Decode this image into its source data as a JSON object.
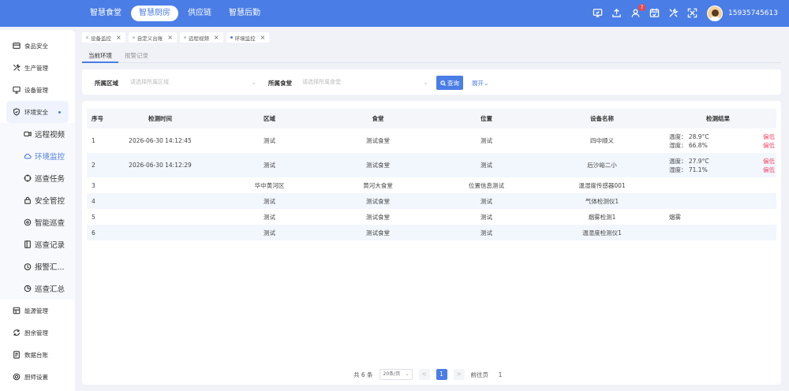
{
  "topnav": {
    "items": [
      "智慧食堂",
      "智慧厨房",
      "供应链",
      "智慧后勤"
    ],
    "active": 1,
    "badge_count": "7",
    "phone": "15935745613"
  },
  "sidebar": {
    "items": [
      {
        "label": "食品安全",
        "icon": "food-safety-icon"
      },
      {
        "label": "生产管理",
        "icon": "tools-icon"
      },
      {
        "label": "设备管理",
        "icon": "monitor-icon"
      },
      {
        "label": "环境安全",
        "icon": "shield-icon"
      }
    ],
    "sub_items": [
      {
        "label": "远程视频",
        "icon": "video-icon"
      },
      {
        "label": "环境监控",
        "icon": "cloud-icon"
      },
      {
        "label": "巡查任务",
        "icon": "target-icon"
      },
      {
        "label": "安全管控",
        "icon": "lock-icon"
      },
      {
        "label": "智能巡查",
        "icon": "smart-icon"
      },
      {
        "label": "巡查记录",
        "icon": "record-icon"
      },
      {
        "label": "报警汇...",
        "icon": "alarm-icon"
      },
      {
        "label": "巡查汇总",
        "icon": "pie-icon"
      }
    ],
    "bottom_items": [
      {
        "label": "能源管理",
        "icon": "energy-icon"
      },
      {
        "label": "厨余管理",
        "icon": "waste-icon"
      },
      {
        "label": "数据台账",
        "icon": "ledger-icon"
      },
      {
        "label": "厨师设置",
        "icon": "settings-icon"
      }
    ]
  },
  "tabs": [
    "设备监控",
    "自定义台账",
    "远程视频",
    "环境监控"
  ],
  "subtabs": [
    "当前环境",
    "报警记录"
  ],
  "filter": {
    "area_label": "所属区域",
    "area_placeholder": "请选择所属区域",
    "canteen_label": "所属食堂",
    "canteen_placeholder": "请选择所属食堂",
    "search_label": "查询",
    "expand_label": "展开"
  },
  "table": {
    "headers": [
      "序号",
      "检测时间",
      "区域",
      "食堂",
      "位置",
      "设备名称",
      "检测结果"
    ],
    "rows": [
      {
        "idx": "1",
        "time": "2026-06-30 14:12:45",
        "area": "测试",
        "canteen": "测试食堂",
        "location": "测试",
        "device": "四中顺义",
        "r1": "温度： 28.9°C",
        "r2": "湿度： 66.8%",
        "flag1": "偏低",
        "flag2": "偏低"
      },
      {
        "idx": "2",
        "time": "2026-06-30 14:12:29",
        "area": "测试",
        "canteen": "测试食堂",
        "location": "测试",
        "device": "后沙峪二小",
        "r1": "温度： 27.9°C",
        "r2": "湿度： 71.1%",
        "flag1": "偏低",
        "flag2": "偏低"
      },
      {
        "idx": "3",
        "time": "",
        "area": "华中黄河区",
        "canteen": "黄河大食堂",
        "location": "位置信息测试",
        "device": "温湿度传感器001",
        "r1": "",
        "r2": "",
        "flag1": "",
        "flag2": ""
      },
      {
        "idx": "4",
        "time": "",
        "area": "测试",
        "canteen": "测试食堂",
        "location": "测试",
        "device": "气体检测仪1",
        "r1": "",
        "r2": "",
        "flag1": "",
        "flag2": ""
      },
      {
        "idx": "5",
        "time": "",
        "area": "测试",
        "canteen": "测试食堂",
        "location": "测试",
        "device": "烟雾检测1",
        "r1": "烟雾",
        "r2": "",
        "flag1": "",
        "flag2": ""
      },
      {
        "idx": "6",
        "time": "",
        "area": "测试",
        "canteen": "测试食堂",
        "location": "测试",
        "device": "温湿度检测仪1",
        "r1": "",
        "r2": "",
        "flag1": "",
        "flag2": ""
      }
    ]
  },
  "pager": {
    "total": "共 6 条",
    "page_size": "20条/页",
    "prev": "<",
    "current": "1",
    "next": ">",
    "goto_label": "前往页",
    "goto_value": "1"
  },
  "colors": {
    "accent": "#4a7de6",
    "warn": "#f0506e"
  }
}
